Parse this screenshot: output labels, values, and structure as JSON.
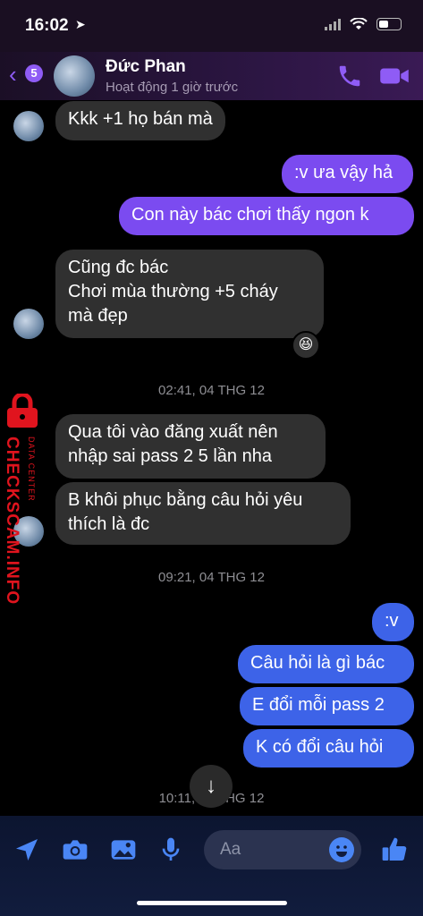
{
  "status": {
    "time": "16:02"
  },
  "header": {
    "back_badge": "5",
    "contact_name": "Đức Phan",
    "contact_status": "Hoạt động 1 giờ trước"
  },
  "messages": [
    {
      "text": "Kkk +1 họ bán mà"
    },
    {
      "text": ":v ưa vậy hả"
    },
    {
      "text": "Con này bác chơi thấy ngon k"
    },
    {
      "text": "Cũng đc bác\nChơi mùa thường +5 cháy\nmà đẹp",
      "reaction": "😆"
    },
    {
      "text": "Qua tôi vào đăng xuất nên\nnhập sai pass 2 5 lần nha"
    },
    {
      "text": "B khôi phục bằng câu hỏi yêu\nthích là đc"
    },
    {
      "text": ":v"
    },
    {
      "text": "Câu hỏi là gì bác"
    },
    {
      "text": "E đổi mỗi pass 2"
    },
    {
      "text": "K có đổi câu hỏi"
    }
  ],
  "timestamps": [
    "02:41, 04 THG 12",
    "09:21, 04 THG 12",
    "10:11, 04 THG 12"
  ],
  "composer": {
    "placeholder": "Aa"
  },
  "watermark": {
    "brand": "CHECKSCAM.INFO",
    "sub": "DATA CENTER"
  },
  "icons": {
    "back": "chevron-left-icon",
    "call": "phone-icon",
    "video": "video-icon",
    "location": "location-arrow-icon",
    "camera": "camera-icon",
    "image": "image-icon",
    "mic": "microphone-icon",
    "emoji": "emoji-icon",
    "like": "thumbs-up-icon",
    "scroll": "arrow-down-icon"
  },
  "colors": {
    "accent_purple": "#7b4bf0",
    "accent_blue": "#3d63e8",
    "incoming": "#303030"
  }
}
